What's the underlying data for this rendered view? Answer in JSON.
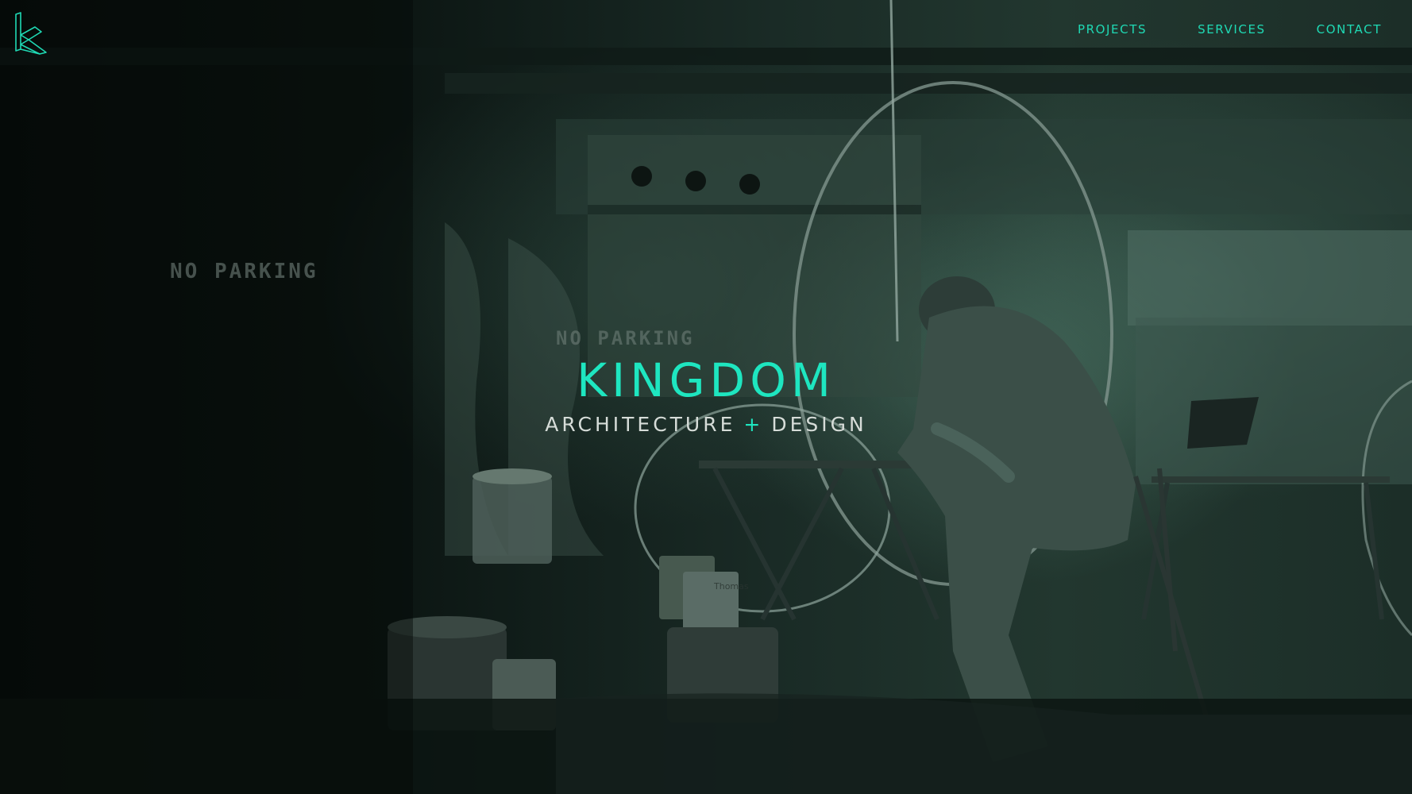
{
  "header": {
    "logo_icon": "kingdom-k-monogram-icon",
    "nav": {
      "projects": "PROJECTS",
      "services": "SERVICES",
      "contact": "CONTACT"
    }
  },
  "hero": {
    "title": "KINGDOM",
    "subtitle_part1": "ARCHITECTURE",
    "subtitle_plus": "+",
    "subtitle_part2": "DESIGN",
    "sign_left": "NO PARKING",
    "sign_center": "NO PARKING",
    "bucket_label": "Thomas"
  },
  "colors": {
    "accent": "#1ee6c0",
    "nav": "#1fd9b4",
    "subtitle": "#d6dcd8",
    "background": "#0b1310"
  }
}
